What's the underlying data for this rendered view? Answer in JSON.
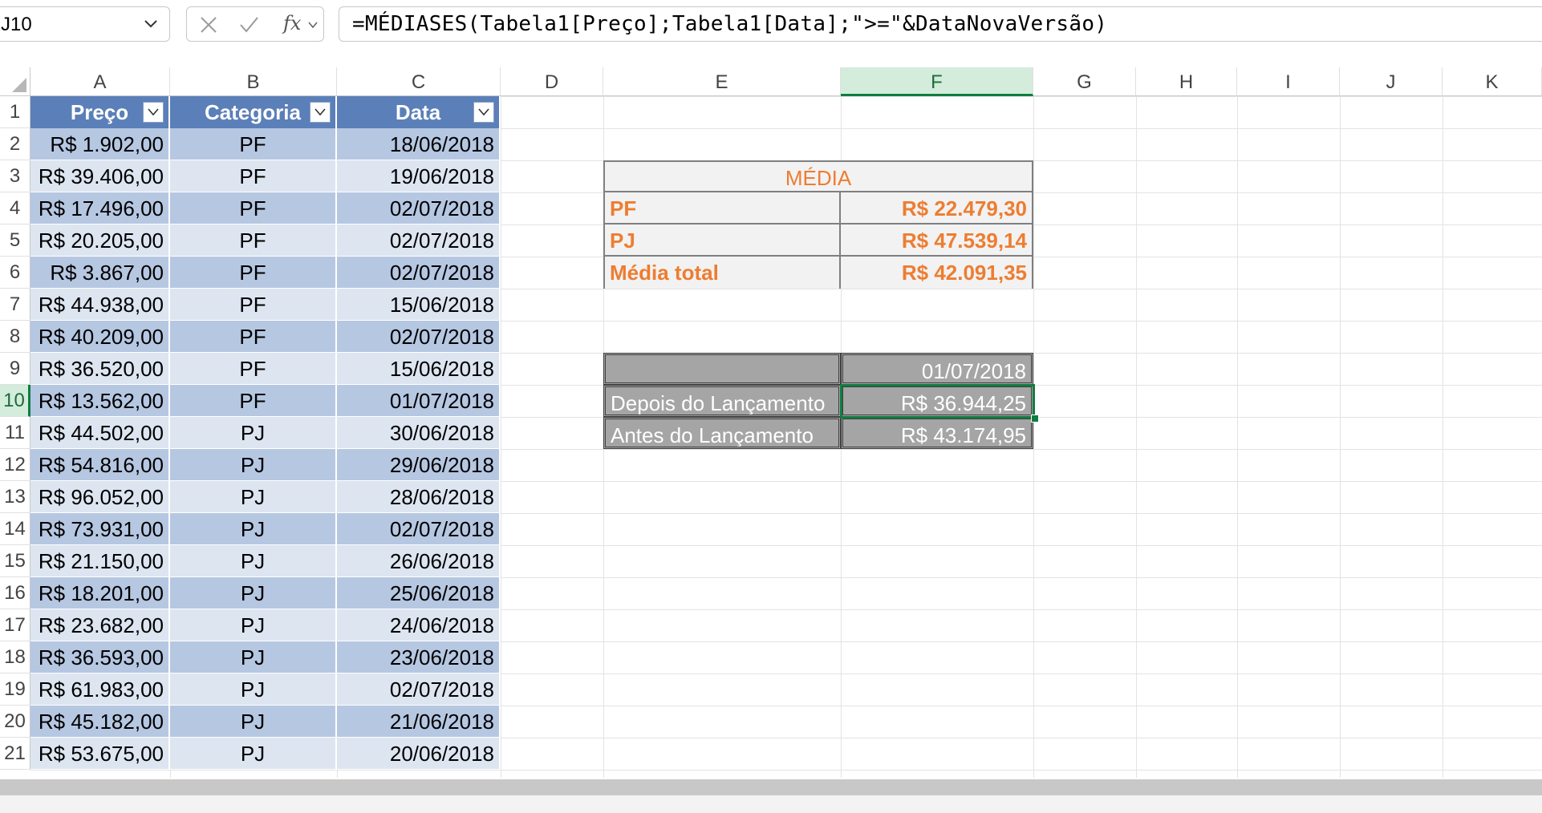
{
  "formula_bar": {
    "name_box": "J10",
    "fx": "fx",
    "formula": "=MÉDIASES(Tabela1[Preço];Tabela1[Data];\">=\"&DataNovaVersão)"
  },
  "columns": [
    "A",
    "B",
    "C",
    "D",
    "E",
    "F",
    "G",
    "H",
    "I",
    "J",
    "K"
  ],
  "rows": [
    "1",
    "2",
    "3",
    "4",
    "5",
    "6",
    "7",
    "8",
    "9",
    "10",
    "11",
    "12",
    "13",
    "14",
    "15",
    "16",
    "17",
    "18",
    "19",
    "20",
    "21"
  ],
  "table": {
    "headers": [
      "Preço",
      "Categoria",
      "Data"
    ],
    "rows": [
      [
        "R$ 1.902,00",
        "PF",
        "18/06/2018"
      ],
      [
        "R$ 39.406,00",
        "PF",
        "19/06/2018"
      ],
      [
        "R$ 17.496,00",
        "PF",
        "02/07/2018"
      ],
      [
        "R$ 20.205,00",
        "PF",
        "02/07/2018"
      ],
      [
        "R$ 3.867,00",
        "PF",
        "02/07/2018"
      ],
      [
        "R$ 44.938,00",
        "PF",
        "15/06/2018"
      ],
      [
        "R$ 40.209,00",
        "PF",
        "02/07/2018"
      ],
      [
        "R$ 36.520,00",
        "PF",
        "15/06/2018"
      ],
      [
        "R$ 13.562,00",
        "PF",
        "01/07/2018"
      ],
      [
        "R$ 44.502,00",
        "PJ",
        "30/06/2018"
      ],
      [
        "R$ 54.816,00",
        "PJ",
        "29/06/2018"
      ],
      [
        "R$ 96.052,00",
        "PJ",
        "28/06/2018"
      ],
      [
        "R$ 73.931,00",
        "PJ",
        "02/07/2018"
      ],
      [
        "R$ 21.150,00",
        "PJ",
        "26/06/2018"
      ],
      [
        "R$ 18.201,00",
        "PJ",
        "25/06/2018"
      ],
      [
        "R$ 23.682,00",
        "PJ",
        "24/06/2018"
      ],
      [
        "R$ 36.593,00",
        "PJ",
        "23/06/2018"
      ],
      [
        "R$ 61.983,00",
        "PJ",
        "02/07/2018"
      ],
      [
        "R$ 45.182,00",
        "PJ",
        "21/06/2018"
      ],
      [
        "R$ 53.675,00",
        "PJ",
        "20/06/2018"
      ]
    ]
  },
  "media": {
    "title": "MÉDIA",
    "rows": [
      {
        "label": "PF",
        "value": "R$ 22.479,30"
      },
      {
        "label": "PJ",
        "value": "R$ 47.539,14"
      },
      {
        "label": "Média total",
        "value": "R$ 42.091,35"
      }
    ]
  },
  "launch": {
    "date": "01/07/2018",
    "rows": [
      {
        "label": "Depois do Lançamento",
        "value": "R$ 36.944,25"
      },
      {
        "label": "Antes do Lançamento",
        "value": "R$ 43.174,95"
      }
    ]
  },
  "colors": {
    "table_header": "#5b7fb8",
    "table_band_dark": "#b6c7e2",
    "table_band_light": "#dde5f1",
    "accent_orange": "#ed7d31",
    "selection_green": "#107c41"
  },
  "icons": [
    "chevron-down-icon",
    "cancel-icon",
    "enter-icon",
    "function-icon",
    "filter-icon"
  ]
}
